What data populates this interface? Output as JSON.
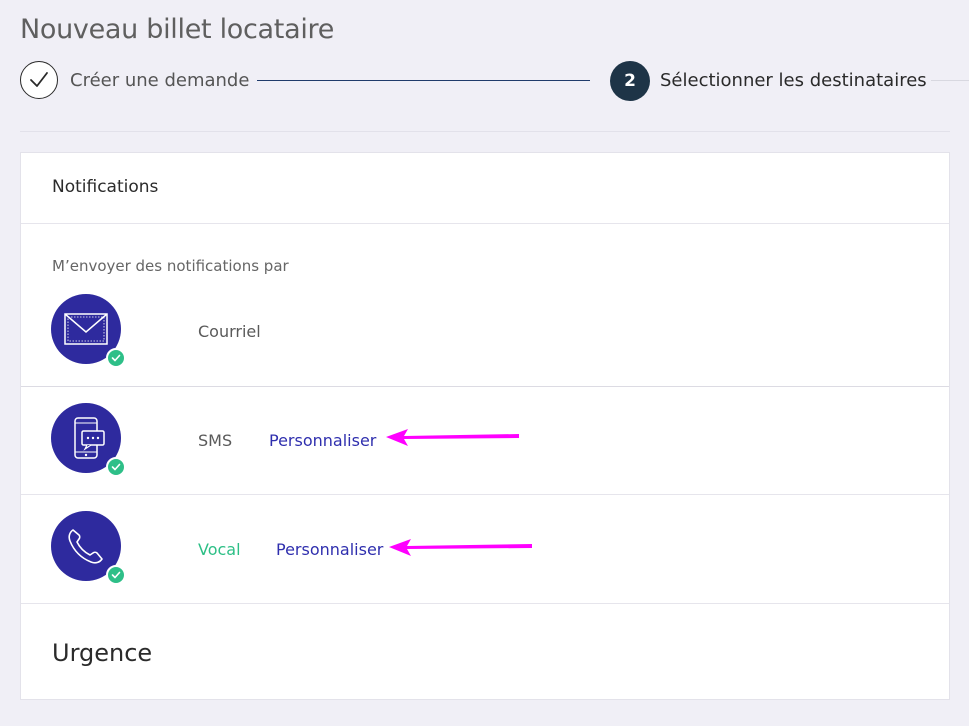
{
  "page": {
    "title": "Nouveau billet locataire"
  },
  "stepper": {
    "step1_label": "Créer une demande",
    "step2_number": "2",
    "step2_label": "Sélectionner les destinataires"
  },
  "notifications": {
    "header": "Notifications",
    "intro": "M’envoyer des notifications par",
    "channels": [
      {
        "icon": "envelope-icon",
        "label": "Courriel",
        "checked": true
      },
      {
        "icon": "mobile-chat-icon",
        "label": "SMS",
        "checked": true,
        "action": "Personnaliser"
      },
      {
        "icon": "phone-icon",
        "label": "Vocal",
        "checked": true,
        "action": "Personnaliser"
      }
    ]
  },
  "urgency": {
    "heading": "Urgence"
  },
  "colors": {
    "channel_icon_bg": "#2e2a9e",
    "check_badge": "#2ebf88",
    "link": "#2f2fae",
    "annotation_arrow": "#ff00ff",
    "active_step": "#1e3447"
  }
}
